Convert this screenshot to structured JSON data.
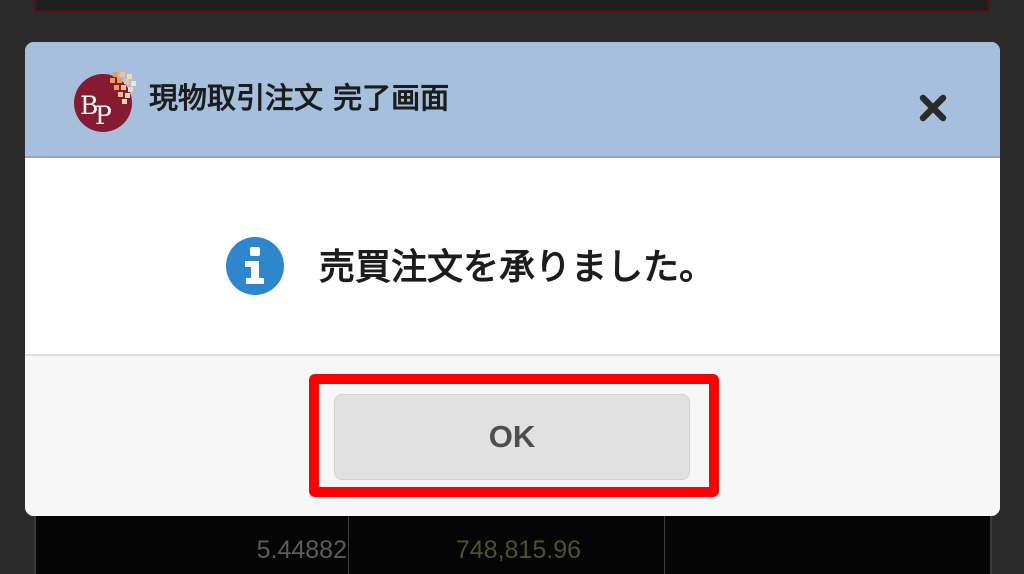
{
  "dialog": {
    "title": "現物取引注文 完了画面",
    "logo_icon": "bp-logo",
    "close_icon": "close-icon",
    "message": "売買注文を承りました。",
    "message_icon": "info-icon",
    "ok_label": "OK"
  },
  "background": {
    "values": [
      "5.44882",
      "748,815.96"
    ]
  },
  "colors": {
    "header_bg": "#a5bfdc",
    "ok_button_bg": "#e1e1e1",
    "highlight": "#ff0000",
    "info_blue": "#2e86cc",
    "logo_maroon": "#861a30"
  }
}
